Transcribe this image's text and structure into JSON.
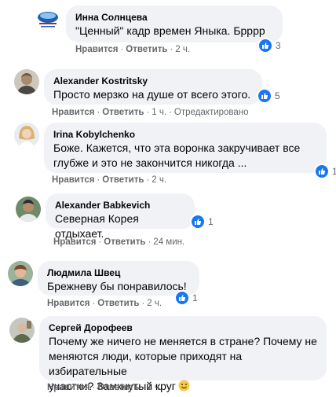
{
  "comments": [
    {
      "author": "Инна Солнцева",
      "text": "\"Ценный\" кадр времен Яныка. Брррр",
      "like_label": "Нравится",
      "reply_label": "Ответить",
      "time": "2 ч.",
      "reaction_count": "3"
    },
    {
      "author": "Alexander Kostritsky",
      "text": "Просто мерзко на душе от всего этого.",
      "like_label": "Нравится",
      "reply_label": "Ответить",
      "time": "1 ч.",
      "edited": "Отредактировано",
      "reaction_count": "5"
    },
    {
      "author": "Irina Kobylchenko",
      "text_line1": "Боже. Кажется, что эта воронка закручивает все",
      "text_line2": "глубже и это не закончится никогда ...",
      "like_label": "Нравится",
      "reply_label": "Ответить",
      "time": "2 ч.",
      "reaction_count": "1"
    },
    {
      "author": "Alexander Babkevich",
      "text": "Северная Корея отдыхает.",
      "like_label": "Нравится",
      "reply_label": "Ответить",
      "time": "24 мин.",
      "reaction_count": "1"
    },
    {
      "author": "Людмила Швец",
      "text": "Брежневу бы понравилось!",
      "like_label": "Нравится",
      "reply_label": "Ответить",
      "time": "2 ч.",
      "reaction_count": "1"
    },
    {
      "author": "Сергей Дорофеев",
      "text_line1": "Почему же ничего не меняется в стране? Почему не",
      "text_line2": "меняются люди, которые приходят на избирательные",
      "text_line3": "участки? Замкнутый круг",
      "like_label": "Нравится",
      "reply_label": "Ответить",
      "time": "1 ч."
    }
  ],
  "colors": {
    "bubble": "#f0f2f5",
    "like_blue": "#1877f2",
    "meta_gray": "#65676b"
  }
}
